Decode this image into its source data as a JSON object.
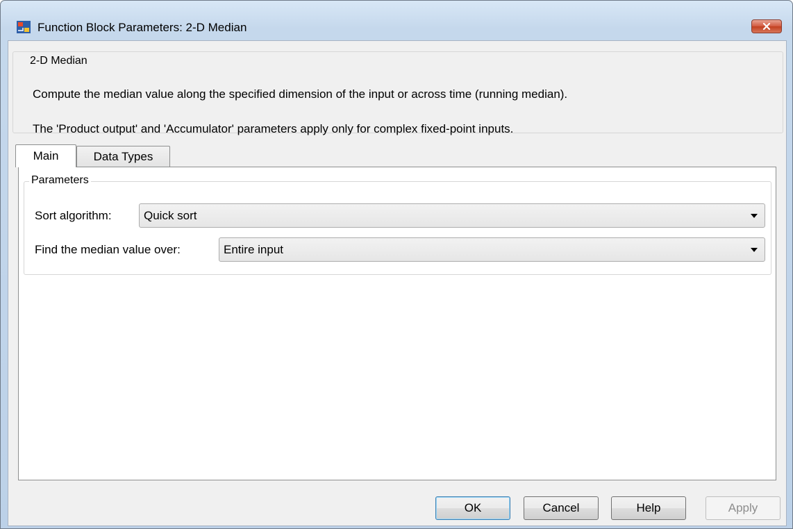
{
  "window": {
    "title": "Function Block Parameters: 2-D Median",
    "close_icon": "close-icon"
  },
  "description": {
    "group_title": "2-D Median",
    "line1": "Compute the median value along the specified dimension of the input or across time (running median).",
    "line2": "The 'Product output' and 'Accumulator' parameters apply only for complex fixed-point inputs."
  },
  "tabs": [
    {
      "label": "Main",
      "selected": true
    },
    {
      "label": "Data Types",
      "selected": false
    }
  ],
  "parameters": {
    "group_title": "Parameters",
    "sort_algorithm": {
      "label": "Sort algorithm:",
      "value": "Quick sort"
    },
    "median_over": {
      "label": "Find the median value over:",
      "value": "Entire input"
    }
  },
  "buttons": {
    "ok": "OK",
    "cancel": "Cancel",
    "help": "Help",
    "apply": "Apply"
  },
  "colors": {
    "title_bar": "#c5d8ec",
    "close_button": "#c2401f",
    "dialog_background": "#f0f0f0",
    "default_button_border": "#3c7fb1"
  }
}
